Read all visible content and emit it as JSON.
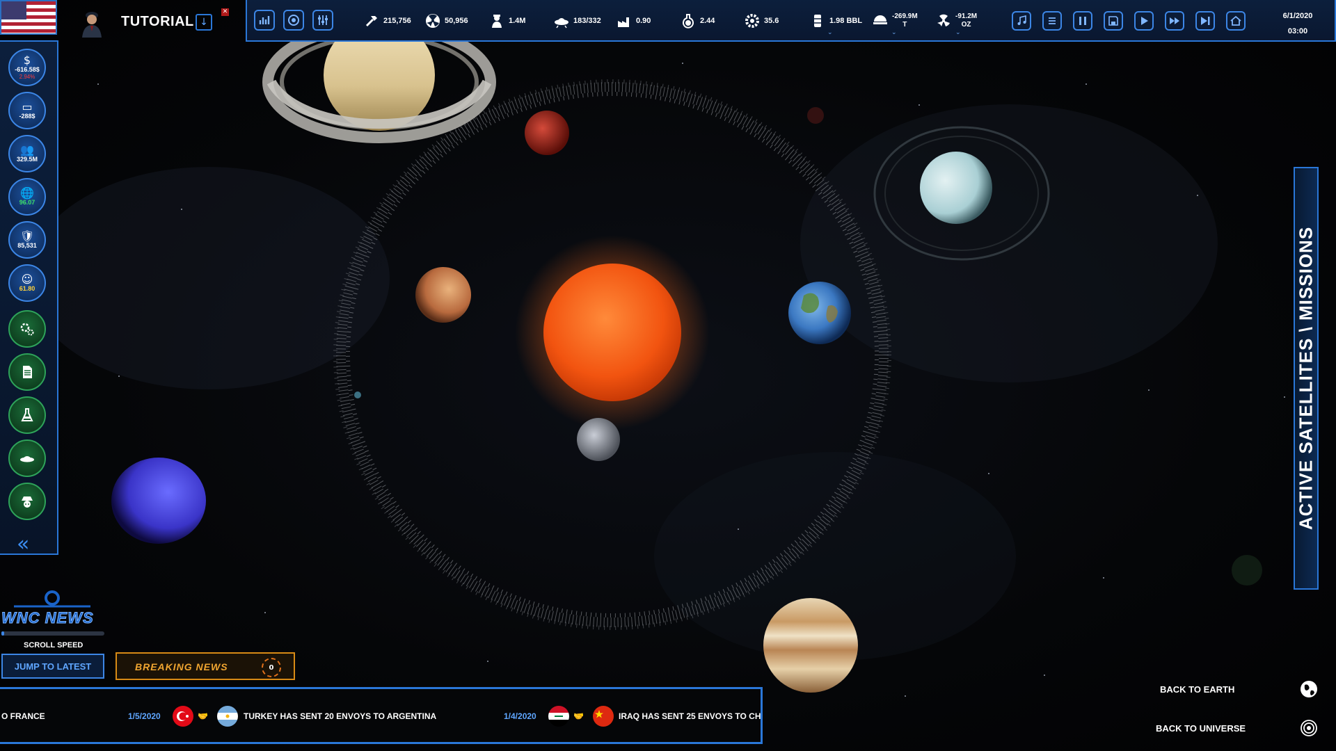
{
  "header": {
    "tutorial_label": "TUTORIAL"
  },
  "sidebar": {
    "stats": [
      {
        "name": "budget",
        "icon": "$",
        "value": "-616.58$",
        "sub": "2.94%",
        "sub_color": "#ff3b3b"
      },
      {
        "name": "income",
        "icon": "▭",
        "value": "-288$",
        "sub": "",
        "sub_color": "#ffffff"
      },
      {
        "name": "population",
        "icon": "👥",
        "value": "329.5M",
        "sub": "",
        "sub_color": "#ffffff"
      },
      {
        "name": "approval",
        "icon": "🌐",
        "value": "96.07",
        "sub": "",
        "sub_color": "#3ee06a"
      },
      {
        "name": "military",
        "icon": "🛡",
        "value": "85,531",
        "sub": "",
        "sub_color": "#ffffff"
      },
      {
        "name": "happiness",
        "icon": "☺",
        "value": "61.80",
        "sub": "",
        "sub_color": "#ffd23a"
      }
    ],
    "collapse_symbol": "«"
  },
  "topbar": {
    "stats": [
      {
        "name": "resources",
        "value": "215,756"
      },
      {
        "name": "nuclear",
        "value": "50,956"
      },
      {
        "name": "personnel",
        "value": "1.4M"
      },
      {
        "name": "satellites",
        "value": "183/332"
      },
      {
        "name": "production",
        "value": "0.90"
      },
      {
        "name": "research",
        "value": "2.44"
      },
      {
        "name": "technology",
        "value": "35.6"
      },
      {
        "name": "oil",
        "value": "1.98 BBL"
      },
      {
        "name": "food",
        "value": "-269.9M",
        "unit": "T"
      },
      {
        "name": "uranium",
        "value": "-91.2M",
        "unit": "OZ"
      }
    ],
    "date": "6/1/2020",
    "time": "03:00"
  },
  "right_panel": {
    "missions_label": "ACTIVE SATELLITES \\ MISSIONS",
    "back_to_earth": "BACK TO EARTH",
    "back_to_universe": "BACK TO UNIVERSE"
  },
  "news": {
    "logo_text": "WNC NEWS",
    "scroll_speed_label": "SCROLL SPEED",
    "scroll_speed": 0.03,
    "jump_label": "JUMP TO LATEST",
    "breaking_label": "BREAKING NEWS",
    "breaking_count": "0",
    "ticker": [
      {
        "date": "",
        "text": "O FRANCE"
      },
      {
        "date": "1/5/2020",
        "text": "TURKEY HAS SENT 20 ENVOYS TO ARGENTINA"
      },
      {
        "date": "1/4/2020",
        "text": "IRAQ HAS SENT 25 ENVOYS TO CHI"
      }
    ]
  },
  "colors": {
    "accent": "#2a77d8",
    "panel": "#0c1f3c",
    "tool_green": "#1a6b38",
    "breaking_orange": "#d88a15"
  }
}
